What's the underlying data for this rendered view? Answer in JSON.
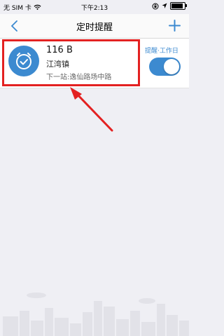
{
  "status_bar": {
    "carrier": "无 SIM 卡",
    "time": "下午2:13"
  },
  "nav": {
    "title": "定时提醒"
  },
  "reminder": {
    "route": "116 B",
    "station": "江湾镇",
    "next_stop": "下一站:逸仙路场中路",
    "remind_label": "提醒·工作日",
    "enabled": true
  },
  "colors": {
    "accent": "#3c8ad0",
    "highlight": "#e32121"
  }
}
